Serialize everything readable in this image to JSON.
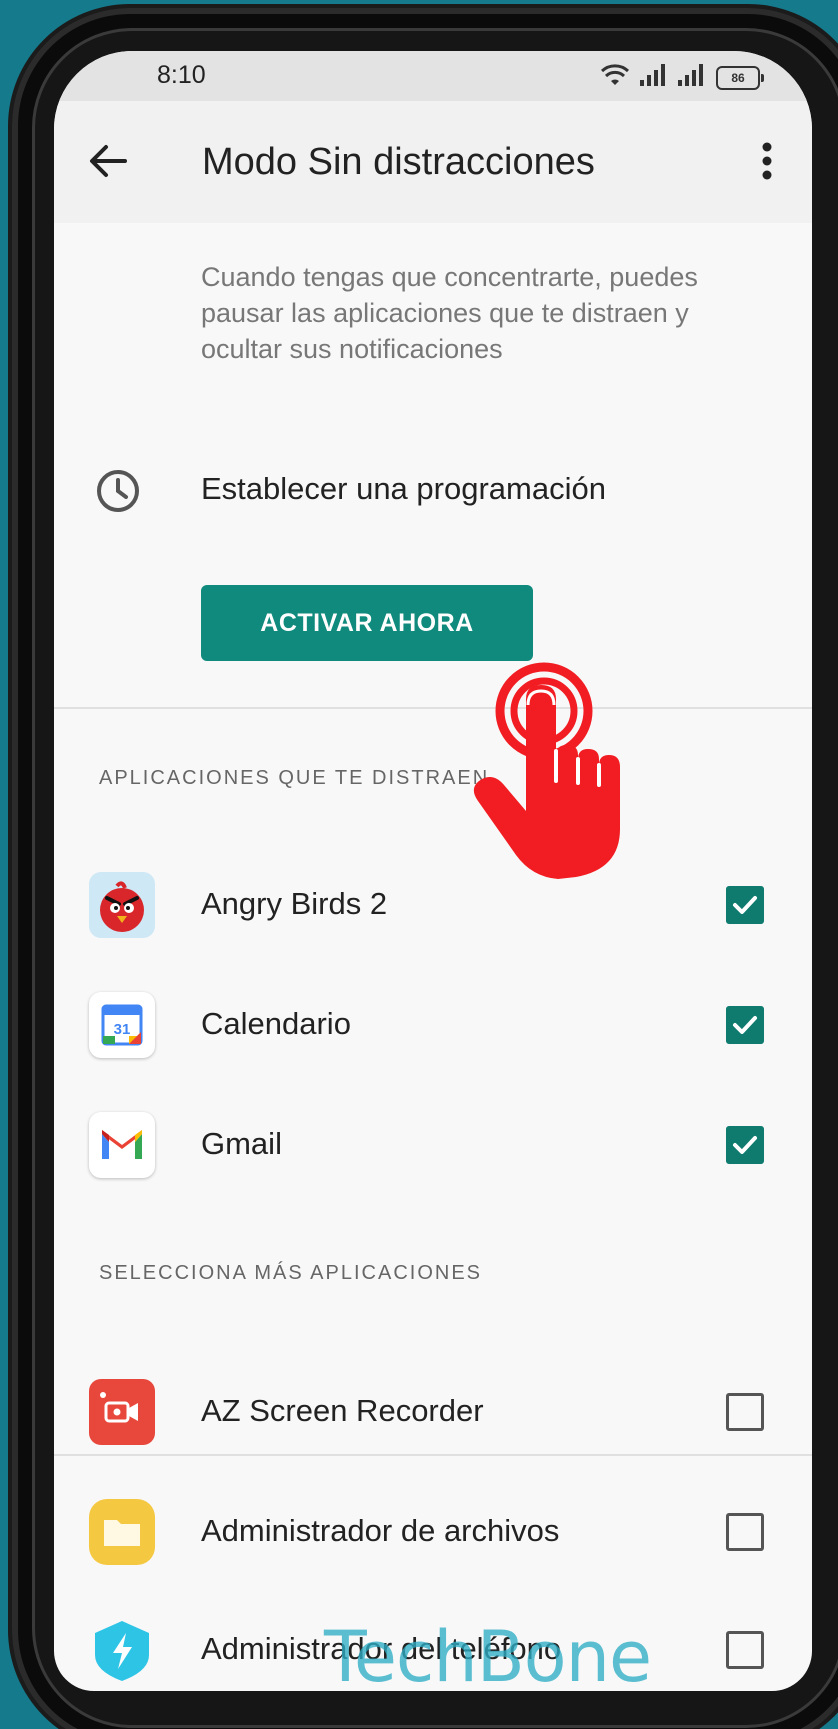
{
  "status_bar": {
    "time": "8:10",
    "battery": "86",
    "icons": [
      "wifi-icon",
      "signal-icon",
      "signal-icon",
      "battery-icon"
    ]
  },
  "app_bar": {
    "title": "Modo Sin distracciones",
    "back_icon": "arrow-left-icon",
    "more_icon": "more-vert-icon"
  },
  "description": "Cuando tengas que concentrarte, puedes pausar las aplicaciones que te distraen y ocultar sus notificaciones",
  "schedule": {
    "label": "Establecer una programación",
    "icon": "clock-icon"
  },
  "activate_button": {
    "label": "ACTIVAR AHORA"
  },
  "sections": {
    "distracting_header": "APLICACIONES QUE TE DISTRAEN",
    "more_header": "SELECCIONA MÁS APLICACIONES"
  },
  "distracting_apps": [
    {
      "name": "Angry Birds 2",
      "checked": true,
      "icon": "angry-birds-icon"
    },
    {
      "name": "Calendario",
      "checked": true,
      "icon": "calendar-icon"
    },
    {
      "name": "Gmail",
      "checked": true,
      "icon": "gmail-icon"
    }
  ],
  "more_apps": [
    {
      "name": "AZ Screen Recorder",
      "checked": false,
      "icon": "screen-recorder-icon"
    },
    {
      "name": "Administrador de archivos",
      "checked": false,
      "icon": "folder-icon"
    },
    {
      "name": "Administrador del teléfono",
      "checked": false,
      "icon": "phone-manager-icon"
    }
  ],
  "calendar_icon_day": "31",
  "watermark": "TechBone",
  "colors": {
    "accent": "#0f8a7d",
    "checkbox": "#0f7a6e",
    "pointer": "#f21d22",
    "background": "#157a8b"
  }
}
